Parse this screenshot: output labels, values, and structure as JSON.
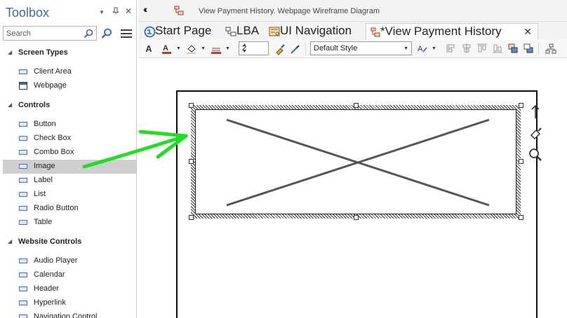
{
  "toolbox": {
    "title": "Toolbox",
    "search_placeholder": "Search",
    "groups": [
      {
        "title": "Screen Types",
        "items": [
          {
            "label": "Client Area"
          },
          {
            "label": "Webpage"
          }
        ]
      },
      {
        "title": "Controls",
        "items": [
          {
            "label": "Button"
          },
          {
            "label": "Check Box"
          },
          {
            "label": "Combo Box"
          },
          {
            "label": "Image",
            "selected": true
          },
          {
            "label": "Label"
          },
          {
            "label": "List"
          },
          {
            "label": "Radio Button"
          },
          {
            "label": "Table"
          }
        ]
      },
      {
        "title": "Website Controls",
        "items": [
          {
            "label": "Audio Player"
          },
          {
            "label": "Calendar"
          },
          {
            "label": "Header"
          },
          {
            "label": "Hyperlink"
          },
          {
            "label": "Navigation Control"
          }
        ]
      }
    ]
  },
  "breadcrumb": {
    "text": "View Payment History.  Webpage Wireframe Diagram"
  },
  "tabs": [
    {
      "label": "Start Page",
      "icon": "start-page-icon"
    },
    {
      "label": "LBA",
      "icon": "diagram-icon"
    },
    {
      "label": "UI Navigation",
      "icon": "ui-navigation-icon"
    },
    {
      "label": "*View Payment History",
      "icon": "webpage-diagram-icon",
      "active": true,
      "close": "✕"
    }
  ],
  "format_toolbar": {
    "line_width": "2",
    "style_value": "Default Style"
  },
  "colors": {
    "toolbox_title": "#3d6aa0",
    "selected_item_bg": "#cfcfcf",
    "annotation_arrow": "#22dd22"
  }
}
